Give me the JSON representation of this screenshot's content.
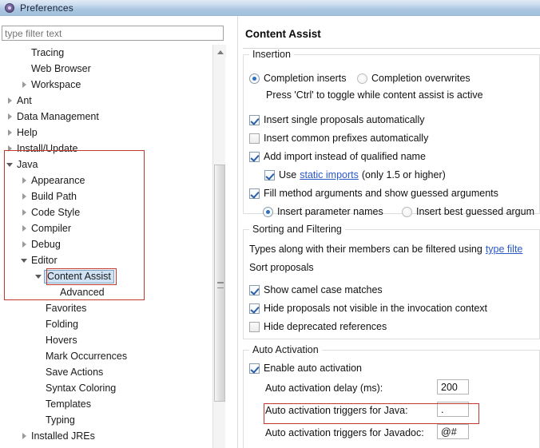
{
  "window": {
    "title": "Preferences",
    "icon": "preferences-gear-icon"
  },
  "filter": {
    "placeholder": "type filter text",
    "value": ""
  },
  "tree": {
    "items": [
      {
        "label": "Tracing",
        "indent": 2,
        "arrow": "none"
      },
      {
        "label": "Web Browser",
        "indent": 2,
        "arrow": "none"
      },
      {
        "label": "Workspace",
        "indent": 2,
        "arrow": "collapsed"
      },
      {
        "label": "Ant",
        "indent": 1,
        "arrow": "collapsed"
      },
      {
        "label": "Data Management",
        "indent": 1,
        "arrow": "collapsed"
      },
      {
        "label": "Help",
        "indent": 1,
        "arrow": "collapsed"
      },
      {
        "label": "Install/Update",
        "indent": 1,
        "arrow": "collapsed"
      },
      {
        "label": "Java",
        "indent": 1,
        "arrow": "expanded"
      },
      {
        "label": "Appearance",
        "indent": 2,
        "arrow": "collapsed"
      },
      {
        "label": "Build Path",
        "indent": 2,
        "arrow": "collapsed"
      },
      {
        "label": "Code Style",
        "indent": 2,
        "arrow": "collapsed"
      },
      {
        "label": "Compiler",
        "indent": 2,
        "arrow": "collapsed"
      },
      {
        "label": "Debug",
        "indent": 2,
        "arrow": "collapsed"
      },
      {
        "label": "Editor",
        "indent": 2,
        "arrow": "expanded"
      },
      {
        "label": "Content Assist",
        "indent": 3,
        "arrow": "expanded",
        "selected": true
      },
      {
        "label": "Advanced",
        "indent": 4,
        "arrow": "none"
      },
      {
        "label": "Favorites",
        "indent": 3,
        "arrow": "none"
      },
      {
        "label": "Folding",
        "indent": 3,
        "arrow": "none"
      },
      {
        "label": "Hovers",
        "indent": 3,
        "arrow": "none"
      },
      {
        "label": "Mark Occurrences",
        "indent": 3,
        "arrow": "none"
      },
      {
        "label": "Save Actions",
        "indent": 3,
        "arrow": "none"
      },
      {
        "label": "Syntax Coloring",
        "indent": 3,
        "arrow": "none"
      },
      {
        "label": "Templates",
        "indent": 3,
        "arrow": "none"
      },
      {
        "label": "Typing",
        "indent": 3,
        "arrow": "none"
      },
      {
        "label": "Installed JREs",
        "indent": 2,
        "arrow": "collapsed"
      }
    ]
  },
  "page": {
    "title": "Content Assist"
  },
  "insertion": {
    "group_title": "Insertion",
    "radio_inserts": "Completion inserts",
    "radio_overwrites": "Completion overwrites",
    "hint": "Press 'Ctrl' to toggle while content assist is active",
    "cb_single_proposals": "Insert single proposals automatically",
    "cb_common_prefixes": "Insert common prefixes automatically",
    "cb_add_import": "Add import instead of qualified name",
    "static_use": "Use",
    "static_link": "static imports",
    "static_suffix": "(only 1.5 or higher)",
    "cb_fill_method": "Fill method arguments and show guessed arguments",
    "radio_param_names": "Insert parameter names",
    "radio_best_guessed": "Insert best guessed argum"
  },
  "sorting": {
    "group_title": "Sorting and Filtering",
    "desc_prefix": "Types along with their members can be filtered using",
    "desc_link": "type filte",
    "sort_label": "Sort proposals",
    "cb_camel_case": "Show camel case matches",
    "cb_hide_not_visible": "Hide proposals not visible in the invocation context",
    "cb_hide_deprecated": "Hide deprecated references"
  },
  "auto_activation": {
    "group_title": "Auto Activation",
    "cb_enable": "Enable auto activation",
    "delay_label": "Auto activation delay (ms):",
    "delay_value": "200",
    "java_label": "Auto activation triggers for Java:",
    "java_value": ".",
    "javadoc_label": "Auto activation triggers for Javadoc:",
    "javadoc_value": "@#"
  },
  "annotations": {
    "color": "#c0392b",
    "boxes": [
      "java-subtree-box",
      "content-assist-item-box",
      "java-triggers-row-box"
    ]
  }
}
